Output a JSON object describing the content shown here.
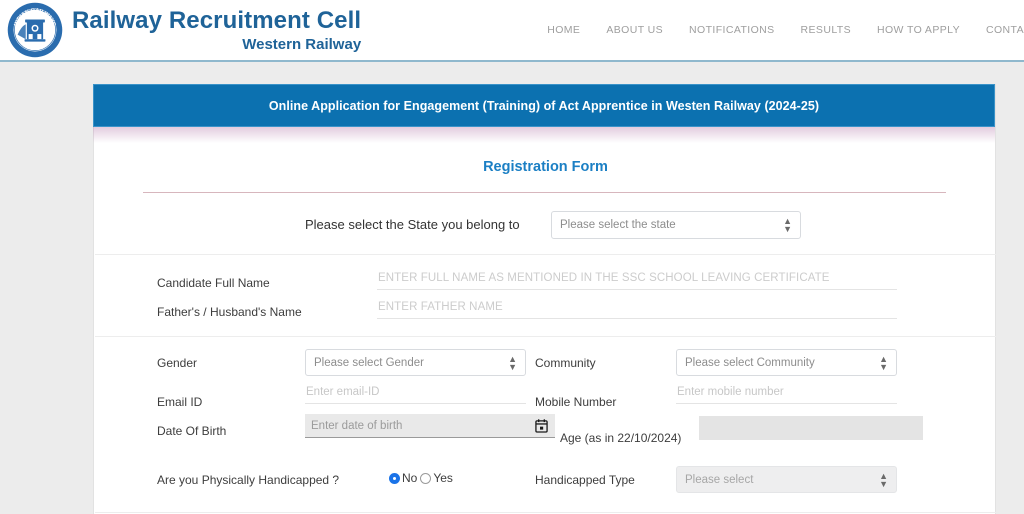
{
  "header": {
    "logo_icon": "indian-railways-emblem-icon",
    "brand_title": "Railway Recruitment Cell",
    "brand_subtitle": "Western Railway",
    "nav": [
      {
        "label": "HOME"
      },
      {
        "label": "ABOUT US"
      },
      {
        "label": "NOTIFICATIONS"
      },
      {
        "label": "RESULTS"
      },
      {
        "label": "HOW TO APPLY"
      },
      {
        "label": "CONTACT"
      }
    ]
  },
  "banner": {
    "text": "Online Application for Engagement (Training) of Act Apprentice in Westen Railway (2024-25)",
    "color": "#0c71b0"
  },
  "form": {
    "title": "Registration Form",
    "title_color": "#1b7fc4",
    "state": {
      "label": "Please select the State you belong to",
      "value": "Please select the state"
    },
    "candidate_name": {
      "label": "Candidate Full Name",
      "placeholder": "ENTER FULL NAME AS MENTIONED IN THE SSC SCHOOL LEAVING CERTIFICATE",
      "value": ""
    },
    "father_name": {
      "label": "Father's / Husband's Name",
      "placeholder": "ENTER FATHER NAME",
      "value": ""
    },
    "gender": {
      "label": "Gender",
      "value": "Please select Gender"
    },
    "community": {
      "label": "Community",
      "value": "Please select Community"
    },
    "email": {
      "label": "Email ID",
      "placeholder": "Enter email-ID",
      "value": ""
    },
    "mobile": {
      "label": "Mobile Number",
      "placeholder": "Enter mobile number",
      "value": ""
    },
    "dob": {
      "label": "Date Of Birth",
      "placeholder": "Enter date of birth",
      "value": "",
      "icon": "calendar-icon"
    },
    "age": {
      "label": "Age (as in 22/10/2024)",
      "value": ""
    },
    "handicapped": {
      "label": "Are you Physically Handicapped ?",
      "option_no": "No",
      "option_yes": "Yes",
      "selected": "No"
    },
    "handicapped_type": {
      "label": "Handicapped Type",
      "value": "Please select",
      "disabled": true
    }
  }
}
